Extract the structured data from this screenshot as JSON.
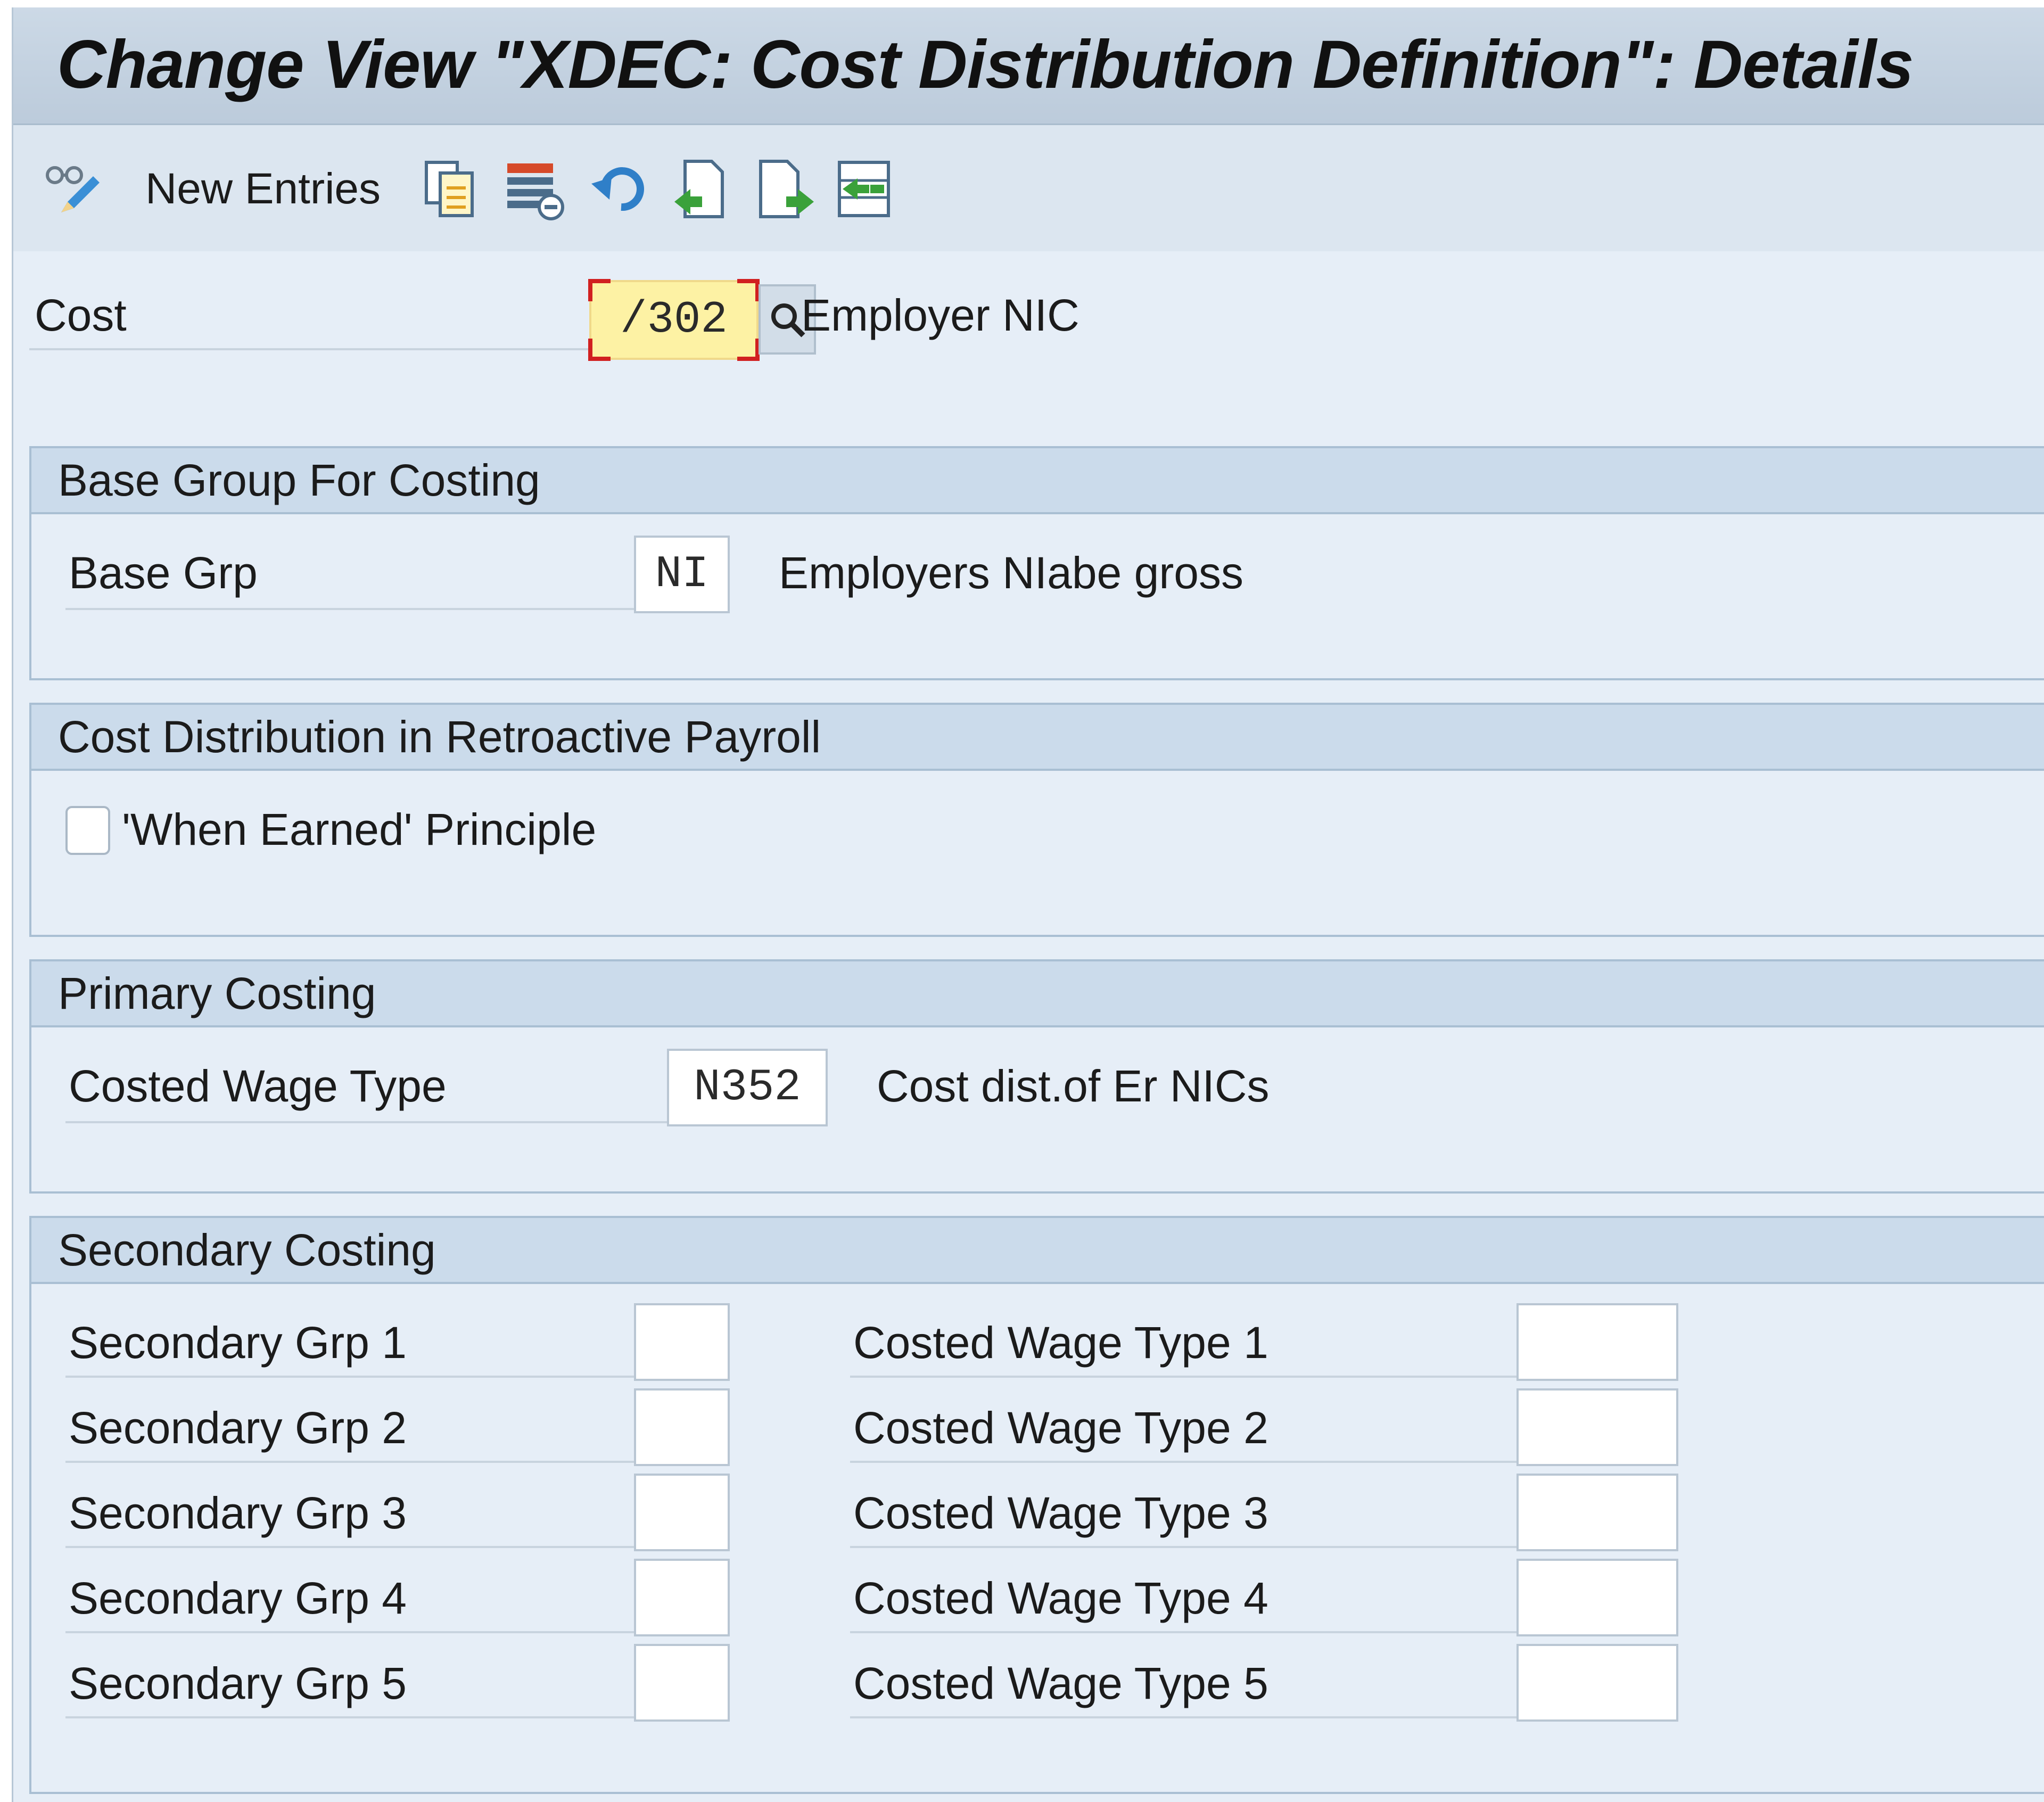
{
  "window": {
    "title": "Change View \"XDEC: Cost Distribution Definition\": Details"
  },
  "toolbar": {
    "display_change_icon": "display-change-icon",
    "new_entries_label": "New Entries",
    "icons": [
      "copy-icon",
      "delete-icon",
      "undo-icon",
      "previous-entry-icon",
      "next-entry-icon",
      "other-entry-icon"
    ]
  },
  "header": {
    "cost_label": "Cost",
    "cost_value": "/302",
    "cost_description": "Employer NIC"
  },
  "base_group": {
    "heading": "Base Group For Costing",
    "base_grp_label": "Base Grp",
    "base_grp_value": "NI",
    "base_grp_description": "Employers NIabe gross"
  },
  "retro": {
    "heading": "Cost Distribution in Retroactive Payroll",
    "when_earned_label": "'When Earned' Principle",
    "when_earned_checked": false
  },
  "primary": {
    "heading": "Primary Costing",
    "costed_wage_type_label": "Costed Wage Type",
    "costed_wage_type_value": "N352",
    "costed_wage_type_description": "Cost dist.of Er NICs"
  },
  "secondary": {
    "heading": "Secondary Costing",
    "rows": [
      {
        "grp_label": "Secondary Grp 1",
        "grp_value": "",
        "wt_label": "Costed Wage Type 1",
        "wt_value": ""
      },
      {
        "grp_label": "Secondary Grp 2",
        "grp_value": "",
        "wt_label": "Costed Wage Type 2",
        "wt_value": ""
      },
      {
        "grp_label": "Secondary Grp 3",
        "grp_value": "",
        "wt_label": "Costed Wage Type 3",
        "wt_value": ""
      },
      {
        "grp_label": "Secondary Grp 4",
        "grp_value": "",
        "wt_label": "Costed Wage Type 4",
        "wt_value": ""
      },
      {
        "grp_label": "Secondary Grp 5",
        "grp_value": "",
        "wt_label": "Costed Wage Type 5",
        "wt_value": ""
      }
    ]
  },
  "colors": {
    "background": "#e6eef7",
    "group_header": "#cbdbeb",
    "focus_field": "#fdf2a4",
    "focus_corner": "#d12020"
  }
}
